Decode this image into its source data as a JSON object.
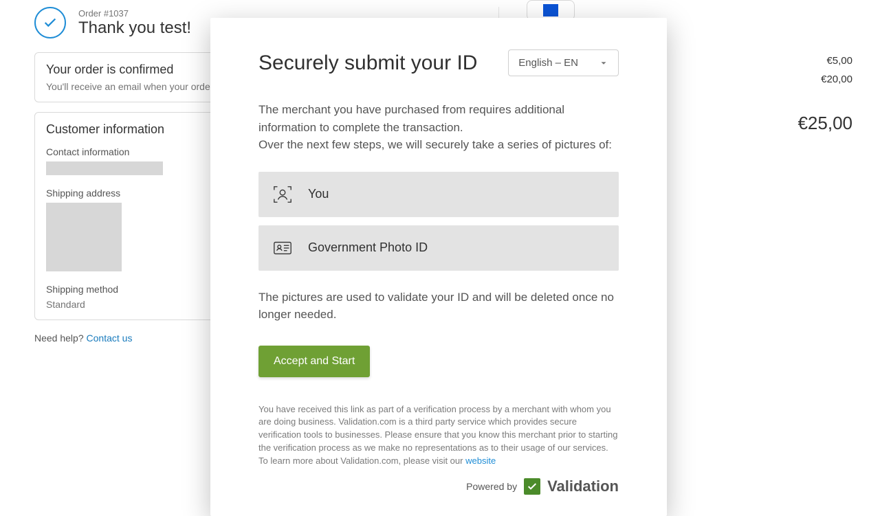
{
  "order": {
    "number_label": "Order #1037",
    "thank_you": "Thank you test!",
    "confirmed_title": "Your order is confirmed",
    "confirmed_sub": "You'll receive an email when your order is ready.",
    "customer_info_title": "Customer information",
    "contact_label": "Contact information",
    "shipping_address_label": "Shipping address",
    "shipping_method_label": "Shipping method",
    "shipping_method_value": "Standard",
    "help_text": "Need help? ",
    "contact_link": "Contact us"
  },
  "summary": {
    "line1": "€5,00",
    "line2": "€20,00",
    "total": "€25,00"
  },
  "modal": {
    "title": "Securely submit your ID",
    "language_selected": "English – EN",
    "intro_1": "The merchant you have purchased from requires additional information to complete the transaction.",
    "intro_2": "Over the next few steps, we will securely take a series of pictures of:",
    "step_you": "You",
    "step_id": "Government Photo ID",
    "deletion_note": "The pictures are used to validate your ID and will be deleted once no longer needed.",
    "accept_button": "Accept and Start",
    "disclaimer": "You have received this link as part of a verification process by a merchant with whom you are doing business. Validation.com is a third party service which provides secure verification tools to businesses. Please ensure that you know this merchant prior to starting the verification process as we make no representations as to their usage of our services. To learn more about Validation.com, please visit our ",
    "disclaimer_link": "website",
    "powered_by": "Powered by",
    "brand": "Validation"
  }
}
